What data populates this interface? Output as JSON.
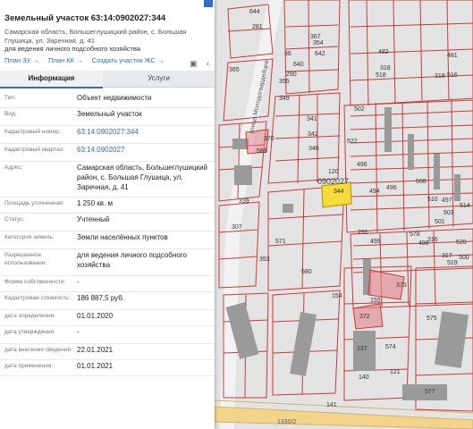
{
  "header": {
    "title": "Земельный участок 63:14:0902027:344",
    "address": "Самарская область, Большеглушицкий район, с. Большая Глушица, ул. Заречная, д. 41",
    "purpose": "для ведения личного подсобного хозяйства",
    "links": [
      "План ЗУ →",
      "План КК →",
      "Создать участок ЖС →"
    ]
  },
  "tabs": [
    "Информация",
    "Услуги"
  ],
  "info": [
    {
      "label": "Тип:",
      "value": "Объект недвижимости"
    },
    {
      "label": "Вид:",
      "value": "Земельный участок"
    },
    {
      "label": "Кадастровый номер:",
      "value": "63:14:0902027:344"
    },
    {
      "label": "Кадастровый квартал:",
      "value": "63:14:0902027"
    },
    {
      "label": "Адрес:",
      "value": "Самарская область, Большеглушицкий район, с. Большая Глушица, ул. Заречная, д. 41"
    },
    {
      "label": "Площадь уточненная:",
      "value": "1 250 кв. м"
    },
    {
      "label": "Статус:",
      "value": "Учтенный"
    },
    {
      "label": "Категория земель:",
      "value": "Земли населённых пунктов"
    },
    {
      "label": "Разрешенное использование:",
      "value": "для ведения личного подсобного хозяйства"
    },
    {
      "label": "Форма собственности:",
      "value": "-"
    },
    {
      "label": "Кадастровая стоимость:",
      "value": "186 887,5 руб."
    },
    {
      "label": "дата определения:",
      "value": "01.01.2020"
    },
    {
      "label": "дата утверждения:",
      "value": "-"
    },
    {
      "label": "дата внесения сведений:",
      "value": "22.01.2021"
    },
    {
      "label": "дата применения:",
      "value": "01.01.2021"
    }
  ],
  "map": {
    "street_label": "улица Молодогвардейцев",
    "block_label": "0902027",
    "road_label": "1330/2",
    "parcel_numbers": [
      "644",
      "281",
      "367",
      "354",
      "36",
      "642",
      "640",
      "290",
      "365",
      "355",
      "349",
      "341",
      "342",
      "346",
      "370",
      "589",
      "502",
      "522",
      "496",
      "344",
      "120",
      "339",
      "307",
      "571",
      "353",
      "580",
      "154",
      "155",
      "373",
      "372",
      "574",
      "575",
      "577",
      "141",
      "137",
      "140",
      "121",
      "508",
      "510",
      "501",
      "496",
      "494",
      "497",
      "503",
      "514",
      "516",
      "318",
      "318",
      "482",
      "481",
      "317",
      "578",
      "316",
      "291",
      "499",
      "498",
      "500",
      "519",
      "520",
      "518"
    ]
  },
  "colors": {
    "accent": "#2f6fc2",
    "parcel_stroke": "#c43a3a",
    "selected_parcel": "#f5dc3a",
    "highlight_parcel": "#e8828a",
    "building": "#9a9a9a",
    "road": "#f2d58a"
  }
}
